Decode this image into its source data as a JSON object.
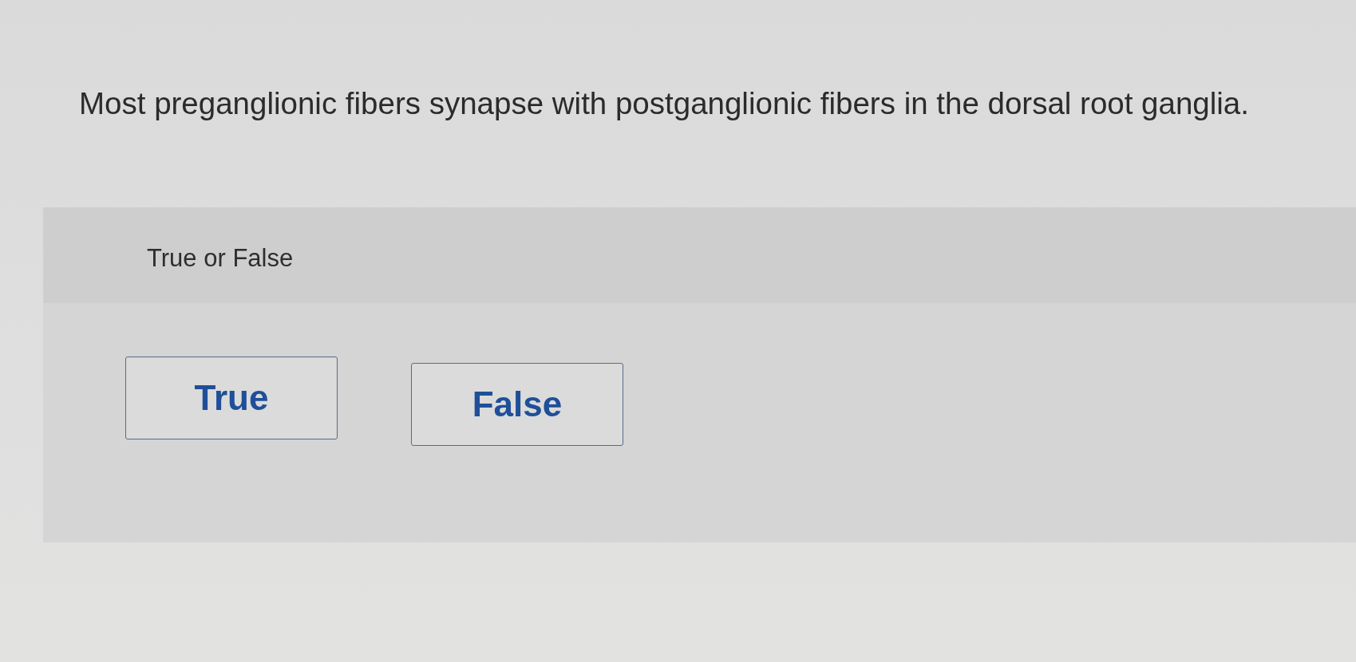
{
  "question": {
    "text": "Most preganglionic fibers synapse with postganglionic fibers in the dorsal root ganglia."
  },
  "answer_panel": {
    "prompt": "True or False",
    "options": [
      {
        "label": "True",
        "selected": false
      },
      {
        "label": "False",
        "selected": false
      }
    ]
  }
}
